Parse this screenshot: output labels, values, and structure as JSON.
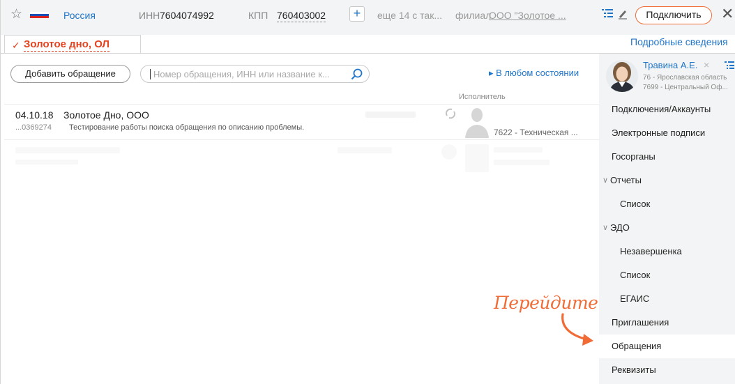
{
  "topbar": {
    "country": "Россия",
    "inn_label": "ИНН",
    "inn_value": "7604074992",
    "kpp_label": "КПП",
    "kpp_value": "760403002",
    "plus": "+",
    "more": "еще 14 с так...",
    "branch_label": "филиал",
    "branch_value": "ООО \"Золотое ...",
    "connect": "Подключить",
    "close": "✕"
  },
  "org_tab": {
    "check": "✓",
    "name": "Золотое дно, ОЛ",
    "details": "Подробные сведения"
  },
  "toolbar": {
    "add_label": "Добавить обращение",
    "search_placeholder": "Номер обращения, ИНН или название к...",
    "state_filter": "▸ В любом состоянии",
    "executor_header": "Исполнитель"
  },
  "rows": [
    {
      "date": "04.10.18",
      "org": "Золотое Дно, ООО",
      "number": "...0369274",
      "description": "Тестирование работы поиска обращения по описанию проблемы.",
      "executor": "7622 - Техническая ..."
    }
  ],
  "user": {
    "name": "Травина А.Е.",
    "close": "×",
    "region": "76 - Ярославская область",
    "office": "7699 - Центральный Оф..."
  },
  "nav": {
    "connections": "Подключения/Аккаунты",
    "signatures": "Электронные подписи",
    "gov": "Госорганы",
    "reports": "Отчеты",
    "reports_list": "Список",
    "edo": "ЭДО",
    "edo_unfinished": "Незавершенка",
    "edo_list": "Список",
    "egais": "ЕГАИС",
    "invites": "Приглашения",
    "requests": "Обращения",
    "requisites": "Реквизиты"
  },
  "annotation": {
    "text": "Перейдите"
  },
  "colors": {
    "accent_orange": "#f06b36",
    "link_blue": "#1f75c9",
    "org_red": "#e2421e",
    "panel_gray": "#f3f4f5"
  }
}
